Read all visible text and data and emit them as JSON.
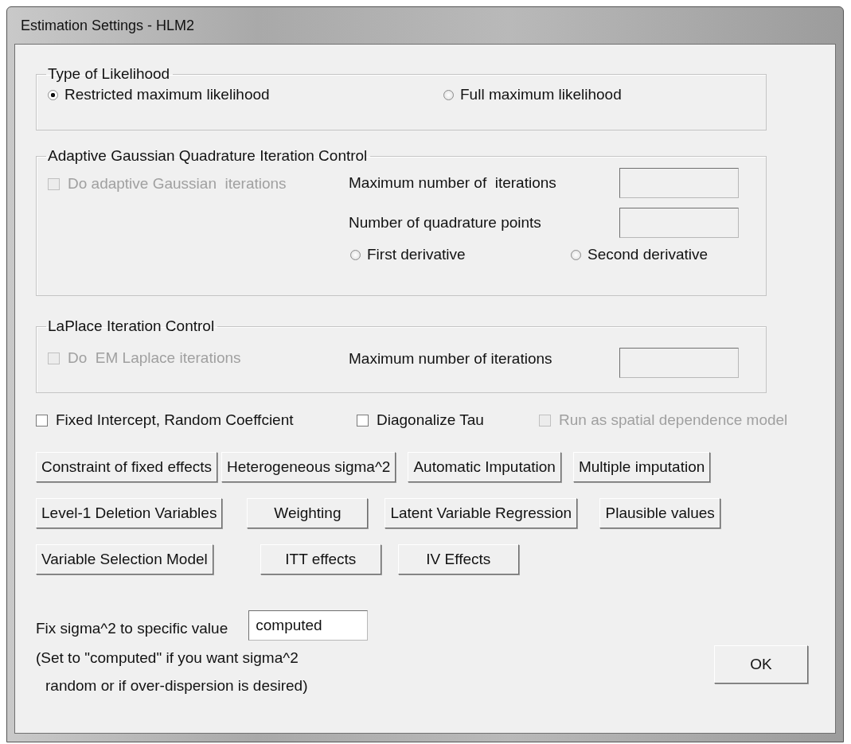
{
  "window": {
    "title": "Estimation Settings - HLM2"
  },
  "likelihood": {
    "title": "Type of Likelihood",
    "options": [
      {
        "label": "Restricted maximum likelihood",
        "selected": true
      },
      {
        "label": "Full maximum likelihood",
        "selected": false
      }
    ]
  },
  "adaptive_quadrature": {
    "title": "Adaptive Gaussian Quadrature Iteration Control",
    "checkbox": {
      "label": "Do adaptive Gaussian  iterations",
      "checked": false,
      "disabled": true
    },
    "fields": [
      {
        "label": "Maximum number of  iterations",
        "disabled": true
      },
      {
        "label": "Number of quadrature points",
        "disabled": true
      }
    ],
    "derivatives": [
      {
        "label": "First derivative",
        "selected": false
      },
      {
        "label": "Second derivative",
        "selected": false
      }
    ]
  },
  "laplace": {
    "title": "LaPlace Iteration Control",
    "checkbox": {
      "label": "Do  EM Laplace iterations",
      "checked": false,
      "disabled": true
    },
    "fields": [
      {
        "label": "Maximum number of iterations",
        "disabled": true
      }
    ]
  },
  "options": [
    {
      "label": "Fixed Intercept, Random Coeffcient",
      "checked": false,
      "disabled": false
    },
    {
      "label": "Diagonalize Tau",
      "checked": false,
      "disabled": false
    },
    {
      "label": "Run as spatial dependence model",
      "checked": false,
      "disabled": true
    }
  ],
  "button_rows": [
    [
      "Constraint of fixed effects",
      "Heterogeneous sigma^2",
      "Automatic Imputation",
      "Multiple imputation"
    ],
    [
      "Level-1 Deletion Variables",
      "Weighting",
      "Latent Variable Regression",
      "Plausible values"
    ],
    [
      "Variable Selection Model",
      "ITT effects",
      "IV Effects"
    ]
  ],
  "sigma": {
    "label": "Fix sigma^2 to specific value",
    "value": "computed",
    "note": [
      "(Set to \"computed\" if you want sigma^2",
      "random or if over-dispersion is desired)"
    ]
  },
  "ok_button": "OK"
}
